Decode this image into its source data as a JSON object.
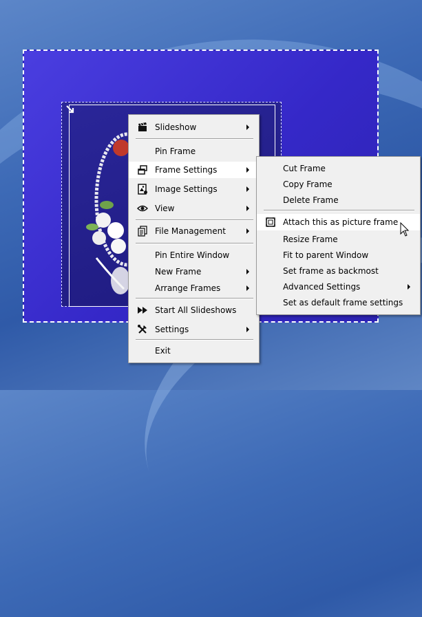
{
  "main_menu": {
    "items": [
      {
        "label": "Slideshow",
        "icon": "clapperboard-icon",
        "submenu": true
      },
      {
        "label": "Pin Frame",
        "icon": "",
        "submenu": false
      },
      {
        "label": "Frame Settings",
        "icon": "frames-icon",
        "submenu": true,
        "highlighted": true
      },
      {
        "label": "Image Settings",
        "icon": "image-settings-icon",
        "submenu": true
      },
      {
        "label": "View",
        "icon": "eye-icon",
        "submenu": true
      },
      {
        "label": "File Management",
        "icon": "documents-icon",
        "submenu": true
      },
      {
        "label": "Pin Entire Window",
        "icon": "",
        "submenu": false
      },
      {
        "label": "New Frame",
        "icon": "",
        "submenu": true
      },
      {
        "label": "Arrange Frames",
        "icon": "",
        "submenu": true
      },
      {
        "label": "Start All Slideshows",
        "icon": "fast-forward-icon",
        "submenu": false
      },
      {
        "label": "Settings",
        "icon": "tools-icon",
        "submenu": true
      },
      {
        "label": "Exit",
        "icon": "",
        "submenu": false
      }
    ]
  },
  "frame_submenu": {
    "items": [
      {
        "label": "Cut Frame"
      },
      {
        "label": "Copy Frame"
      },
      {
        "label": "Delete Frame"
      },
      {
        "label": "Attach this as picture frame",
        "icon": "picture-frame-icon",
        "highlighted": true
      },
      {
        "label": "Resize Frame"
      },
      {
        "label": "Fit to parent Window"
      },
      {
        "label": "Set frame as backmost"
      },
      {
        "label": "Advanced Settings",
        "submenu": true
      },
      {
        "label": "Set as default frame settings"
      }
    ]
  }
}
